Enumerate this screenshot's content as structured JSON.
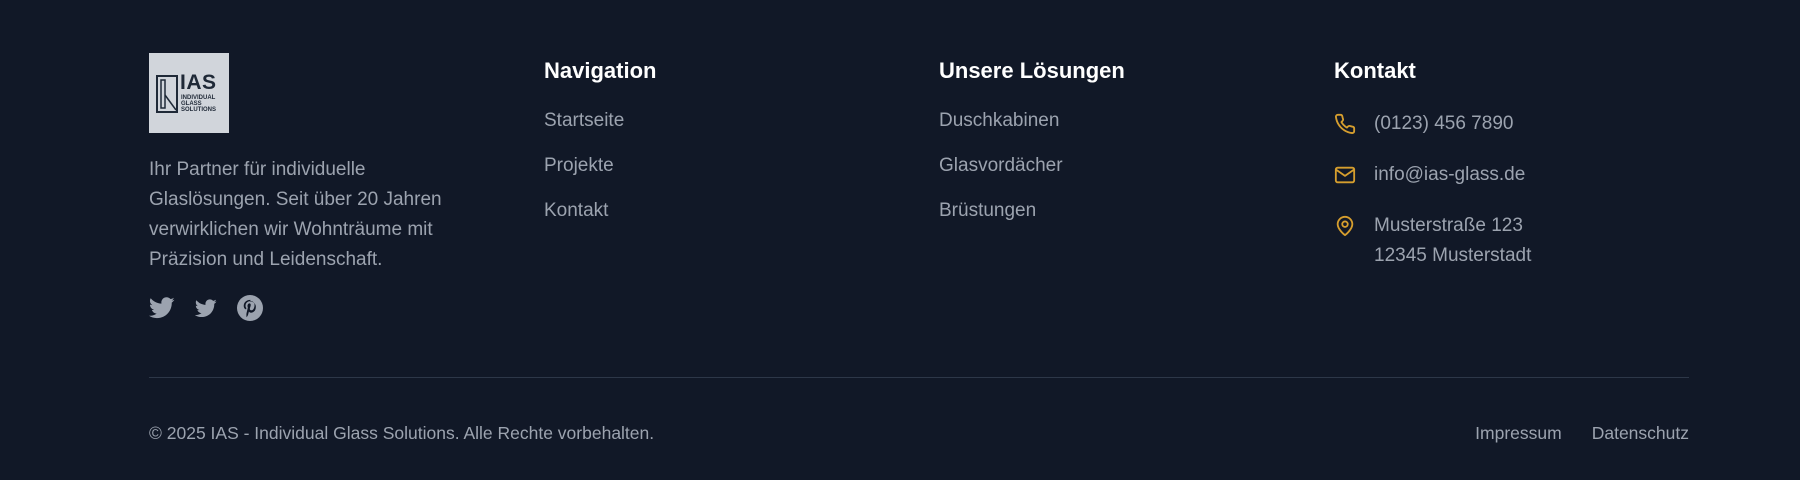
{
  "brand": {
    "logo_text": "IAS",
    "logo_subtext": "INDIVIDUAL\nGLASS\nSOLUTIONS",
    "description": "Ihr Partner für individuelle Glaslösungen. Seit über 20 Jahren verwirklichen wir Wohnträume mit Präzision und Leidenschaft.",
    "socials": [
      {
        "icon": "twitter-icon"
      },
      {
        "icon": "twitter-icon"
      },
      {
        "icon": "pinterest-icon"
      }
    ]
  },
  "navigation": {
    "title": "Navigation",
    "items": [
      "Startseite",
      "Projekte",
      "Kontakt"
    ]
  },
  "solutions": {
    "title": "Unsere Lösungen",
    "items": [
      "Duschkabinen",
      "Glasvordächer",
      "Brüstungen"
    ]
  },
  "contact": {
    "title": "Kontakt",
    "phone": "(0123) 456 7890",
    "email": "info@ias-glass.de",
    "address_line1": "Musterstraße 123",
    "address_line2": "12345 Musterstadt",
    "accent_color": "#d69e2e"
  },
  "bottom": {
    "copyright": "© 2025 IAS - Individual Glass Solutions. Alle Rechte vorbehalten.",
    "links": [
      "Impressum",
      "Datenschutz"
    ]
  },
  "colors": {
    "background": "#111827",
    "text": "#9ca3af",
    "heading": "#ffffff",
    "accent": "#d69e2e"
  }
}
